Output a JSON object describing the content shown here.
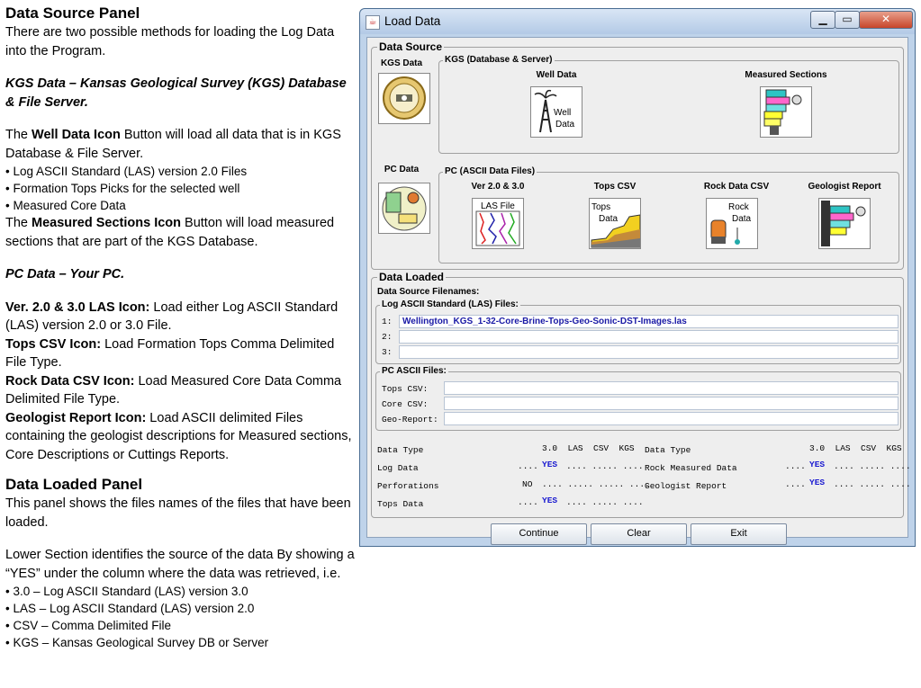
{
  "description": {
    "data_source_heading": "Data Source Panel",
    "intro": "There are two possible methods for loading the Log Data into the Program.",
    "kgs_heading": "KGS Data – Kansas Geological Survey (KGS) Database & File Server.",
    "well_data_p1_bold": "Well Data Icon",
    "well_data_p1_pre": "The ",
    "well_data_p1_post": " Button will load all data that is in KGS Database & File Server.",
    "bullets_kgs": [
      "• Log ASCII Standard (LAS) version 2.0 Files",
      "• Formation Tops Picks for the selected well",
      "• Measured Core Data"
    ],
    "measured_pre": "The ",
    "measured_bold": "Measured Sections Icon",
    "measured_post": " Button will load measured sections that are part of the KGS Database.",
    "pc_heading": "PC Data – Your PC.",
    "las_bold": "Ver. 2.0 & 3.0 LAS Icon:",
    "las_text": " Load either Log ASCII Standard (LAS) version 2.0 or 3.0 File.",
    "tops_bold": "Tops CSV Icon:",
    "tops_text": " Load Formation Tops Comma Delimited File Type.",
    "rock_bold": "Rock Data CSV Icon:",
    "rock_text": " Load Measured Core Data Comma Delimited File Type.",
    "geo_bold": "Geologist Report Icon:",
    "geo_text": " Load ASCII delimited Files containing the geologist descriptions for Measured sections, Core Descriptions or Cuttings Reports.",
    "loaded_heading": "Data Loaded Panel",
    "loaded_text": "This panel shows the files names of the files that have been loaded.",
    "lower_text": "Lower Section identifies the source of the data By showing a “YES” under the column where the data was retrieved, i.e.",
    "bullets_cols": [
      "• 3.0 – Log ASCII Standard (LAS) version 3.0",
      "• LAS – Log ASCII Standard (LAS) version 2.0",
      "• CSV – Comma Delimited File",
      "• KGS – Kansas Geological Survey DB or Server"
    ]
  },
  "window": {
    "title": "Load Data",
    "min_glyph": "▁",
    "max_glyph": "▭",
    "close_glyph": "✕"
  },
  "data_source": {
    "label": "Data Source",
    "kgs_data_label": "KGS Data",
    "kgs_group_label": "KGS (Database & Server)",
    "well_data_label": "Well Data",
    "well_icon_text_1": "Well",
    "well_icon_text_2": "Data",
    "measured_sections_label": "Measured Sections",
    "pc_data_label": "PC Data",
    "pc_group_label": "PC (ASCII Data Files)",
    "ver_label": "Ver 2.0 & 3.0",
    "las_icon_text": "LAS File",
    "tops_label": "Tops CSV",
    "tops_icon_text_1": "Tops",
    "tops_icon_text_2": "Data",
    "rock_label": "Rock Data CSV",
    "rock_icon_text_1": "Rock",
    "rock_icon_text_2": "Data",
    "geo_label": "Geologist Report"
  },
  "data_loaded": {
    "label": "Data Loaded",
    "filenames_label": "Data Source Filenames:",
    "las_files_label": "Log ASCII Standard (LAS) Files:",
    "las_rows": [
      {
        "num": "1:",
        "value": "Wellington_KGS_1-32-Core-Brine-Tops-Geo-Sonic-DST-Images.las"
      },
      {
        "num": "2:",
        "value": ""
      },
      {
        "num": "3:",
        "value": ""
      }
    ],
    "pc_files_label": "PC ASCII Files:",
    "pc_rows": [
      {
        "label": "Tops CSV:",
        "value": ""
      },
      {
        "label": "Core CSV:",
        "value": ""
      },
      {
        "label": "Geo-Report:",
        "value": ""
      }
    ],
    "status_left": {
      "header_type": "Data Type",
      "header_cols": "3.0  LAS  CSV  KGS",
      "rows": [
        {
          "name": "Log Data",
          "dots_pre": "....",
          "flag": "YES",
          "dots_post": ".... ..... ....",
          "color": "#1a1ad0"
        },
        {
          "name": "Perforations",
          "dots_pre": "",
          "flag": "NO",
          "dots_post": ".... ..... ..... ....",
          "color": "#000000"
        },
        {
          "name": "Tops Data",
          "dots_pre": "....",
          "flag": "YES",
          "dots_post": ".... ..... ....",
          "color": "#1a1ad0"
        }
      ]
    },
    "status_right": {
      "header_type": "Data Type",
      "header_cols": "3.0  LAS  CSV  KGS",
      "rows": [
        {
          "name": "Rock Measured Data",
          "dots_pre": "....",
          "flag": "YES",
          "dots_post": ".... ..... ....",
          "color": "#1a1ad0"
        },
        {
          "name": "Geologist Report",
          "dots_pre": "....",
          "flag": "YES",
          "dots_post": ".... ..... ....",
          "color": "#1a1ad0"
        }
      ]
    }
  },
  "buttons": {
    "continue": "Continue",
    "clear": "Clear",
    "exit": "Exit"
  }
}
